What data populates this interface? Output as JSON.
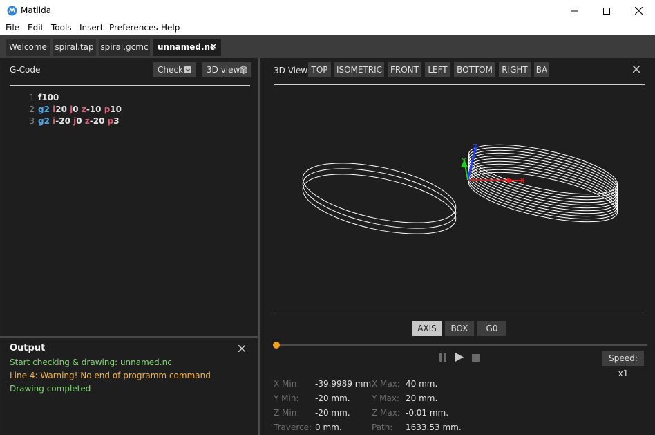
{
  "window": {
    "title": "Matilda"
  },
  "menu": [
    "File",
    "Edit",
    "Tools",
    "Insert",
    "Preferences",
    "Help"
  ],
  "tabs": [
    {
      "label": "Welcome"
    },
    {
      "label": "spiral.tap"
    },
    {
      "label": "spiral.gcmc"
    },
    {
      "label": "unnamed.nc",
      "active": true
    }
  ],
  "gcode": {
    "title": "G-Code",
    "check_label": "Check",
    "view3d_label": "3D view",
    "lines": [
      {
        "n": "1",
        "tokens": [
          {
            "t": "f100",
            "c": "val"
          }
        ]
      },
      {
        "n": "2",
        "tokens": [
          {
            "t": "g2",
            "c": "cmd"
          },
          {
            "t": "i",
            "c": "addr"
          },
          {
            "t": "20",
            "c": "val"
          },
          {
            "t": "j",
            "c": "addr"
          },
          {
            "t": "0",
            "c": "val"
          },
          {
            "t": "z",
            "c": "addr"
          },
          {
            "t": "-10",
            "c": "val"
          },
          {
            "t": "p",
            "c": "addr"
          },
          {
            "t": "10",
            "c": "val"
          }
        ]
      },
      {
        "n": "3",
        "tokens": [
          {
            "t": "g2",
            "c": "cmd"
          },
          {
            "t": "i",
            "c": "addr"
          },
          {
            "t": "-20",
            "c": "val"
          },
          {
            "t": "j",
            "c": "addr"
          },
          {
            "t": "0",
            "c": "val"
          },
          {
            "t": "z",
            "c": "addr"
          },
          {
            "t": "-20",
            "c": "val"
          },
          {
            "t": "p",
            "c": "addr"
          },
          {
            "t": "3",
            "c": "val"
          }
        ]
      }
    ]
  },
  "output": {
    "title": "Output",
    "messages": [
      {
        "text": "Start checking & drawing: unnamed.nc",
        "color": "#7dd66f"
      },
      {
        "text": "Line 4:  Warning! No end of programm command",
        "color": "#f0b04a"
      },
      {
        "text": "Drawing completed",
        "color": "#7dd66f"
      }
    ]
  },
  "view3d": {
    "label": "3D View:",
    "view_buttons": [
      "TOP",
      "ISOMETRIC",
      "FRONT",
      "LEFT",
      "BOTTOM",
      "RIGHT",
      "BA"
    ],
    "axis_labels": {
      "x": "X",
      "y": "Y",
      "z": "Z"
    },
    "toggles": [
      {
        "label": "AXIS",
        "selected": true
      },
      {
        "label": "BOX",
        "selected": false
      },
      {
        "label": "G0",
        "selected": false
      }
    ],
    "progress": 0.0,
    "speed_label": "Speed: x1",
    "stats": [
      {
        "label": "X Min:",
        "value": "-39.9989 mm."
      },
      {
        "label": "X Max:",
        "value": "40 mm."
      },
      {
        "label": "Y Min:",
        "value": "-20 mm."
      },
      {
        "label": "Y Max:",
        "value": "20 mm."
      },
      {
        "label": "Z Min:",
        "value": "-20 mm."
      },
      {
        "label": "Z Max:",
        "value": "-0.01 mm."
      },
      {
        "label": "Traverce:",
        "value": "0 mm."
      },
      {
        "label": "Path:",
        "value": "1633.53 mm."
      }
    ]
  },
  "colors": {
    "accent": "#f0a020",
    "x_axis": "#e02020",
    "y_axis": "#20d020",
    "z_axis": "#2040ff"
  }
}
